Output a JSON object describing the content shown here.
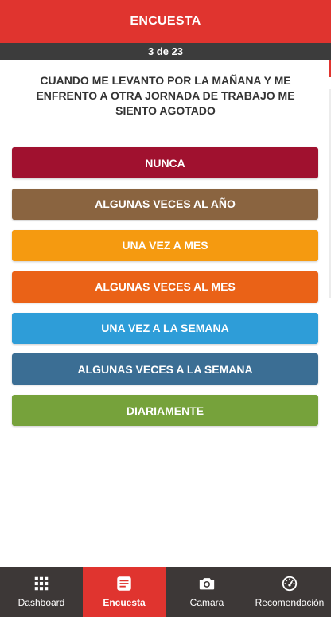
{
  "header": {
    "title": "ENCUESTA"
  },
  "progress": {
    "text": "3 de 23"
  },
  "question": {
    "text": "CUANDO ME LEVANTO POR LA MAÑANA Y ME ENFRENTO A OTRA JORNADA DE TRABAJO ME SIENTO AGOTADO"
  },
  "options": [
    {
      "label": "NUNCA",
      "color": "#a0112f"
    },
    {
      "label": "ALGUNAS VECES AL AÑO",
      "color": "#8a6440"
    },
    {
      "label": "UNA VEZ A MES",
      "color": "#f59a10"
    },
    {
      "label": "ALGUNAS VECES AL MES",
      "color": "#ea6217"
    },
    {
      "label": "UNA VEZ A LA SEMANA",
      "color": "#2e9dd8"
    },
    {
      "label": "ALGUNAS VECES A LA SEMANA",
      "color": "#3b6e94"
    },
    {
      "label": "DIARIAMENTE",
      "color": "#76a23b"
    }
  ],
  "nav": {
    "items": [
      {
        "label": "Dashboard",
        "icon": "grid-icon"
      },
      {
        "label": "Encuesta",
        "icon": "survey-icon",
        "active": true
      },
      {
        "label": "Camara",
        "icon": "camera-icon"
      },
      {
        "label": "Recomendación",
        "icon": "speedometer-icon"
      }
    ]
  },
  "colors": {
    "accent": "#e0342f",
    "navbar": "#3d3837",
    "progress_bar": "#3c3c3c"
  }
}
